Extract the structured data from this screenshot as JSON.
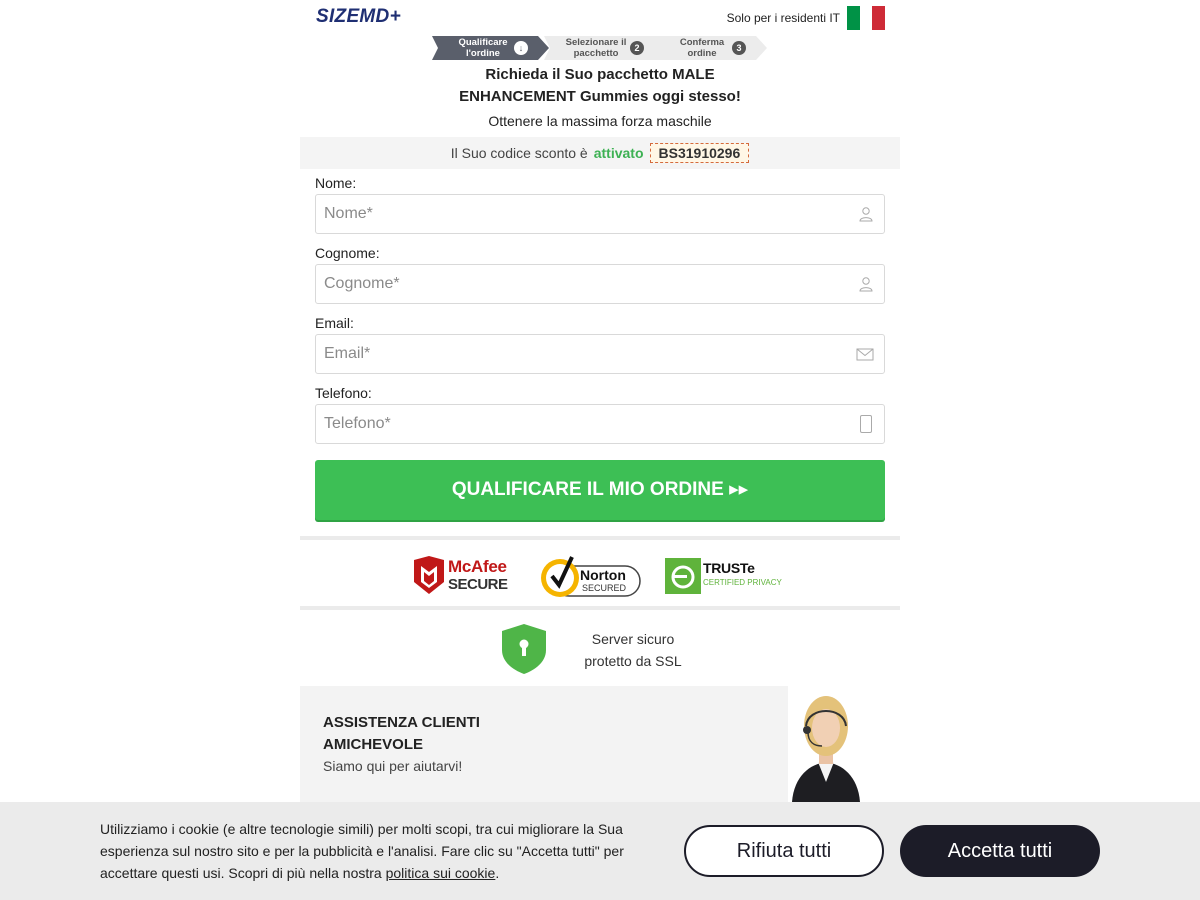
{
  "header": {
    "logo": "SIZEMD+",
    "residents": "Solo per i residenti IT",
    "flag_colors": [
      "#009246",
      "#ffffff",
      "#ce2b37"
    ]
  },
  "steps": [
    {
      "label_line1": "Qualificare",
      "label_line2": "l'ordine",
      "marker": "↓",
      "active": true
    },
    {
      "label_line1": "Selezionare il",
      "label_line2": "pacchetto",
      "marker": "2",
      "active": false
    },
    {
      "label_line1": "Conferma",
      "label_line2": "ordine",
      "marker": "3",
      "active": false
    }
  ],
  "title_line1": "Richieda il Suo pacchetto MALE",
  "title_line2": "ENHANCEMENT Gummies oggi stesso!",
  "subtitle": "Ottenere la massima forza maschile",
  "promo": {
    "prefix": "Il Suo codice sconto è",
    "status": "attivato",
    "code": "BS31910296"
  },
  "form": {
    "first_name": {
      "label": "Nome:",
      "placeholder": "Nome*",
      "icon": "user-icon"
    },
    "last_name": {
      "label": "Cognome:",
      "placeholder": "Cognome*",
      "icon": "user-icon"
    },
    "email": {
      "label": "Email:",
      "placeholder": "Email*",
      "icon": "envelope-icon"
    },
    "phone": {
      "label": "Telefono:",
      "placeholder": "Telefono*",
      "icon": "phone-icon"
    },
    "submit_label": "QUALIFICARE IL MIO ORDINE ▸▸"
  },
  "badges": {
    "mcafee_line1": "McAfee",
    "mcafee_line2": "SECURE",
    "norton_line1": "Norton",
    "norton_line2": "SECURED",
    "truste_line1": "TRUSTe",
    "truste_line2": "CERTIFIED PRIVACY"
  },
  "ssl": {
    "line1": "Server sicuro",
    "line2": "protetto da SSL"
  },
  "support": {
    "heading_line1": "ASSISTENZA CLIENTI",
    "heading_line2": "AMICHEVOLE",
    "subtext": "Siamo qui per aiutarvi!"
  },
  "cookie": {
    "text": "Utilizziamo i cookie (e altre tecnologie simili) per molti scopi, tra cui migliorare la Sua esperienza sul nostro sito e per la pubblicità e l'analisi. Fare clic su \"Accetta tutti\" per accettare questi usi. Scopri di più nella nostra ",
    "link": "politica sui cookie",
    "suffix": ".",
    "reject_label": "Rifiuta tutti",
    "accept_label": "Accetta tutti"
  },
  "colors": {
    "brand_navy": "#1f2f73",
    "cta_green": "#3dbf55",
    "active_green": "#3db153",
    "dark_button": "#1c1c28"
  }
}
